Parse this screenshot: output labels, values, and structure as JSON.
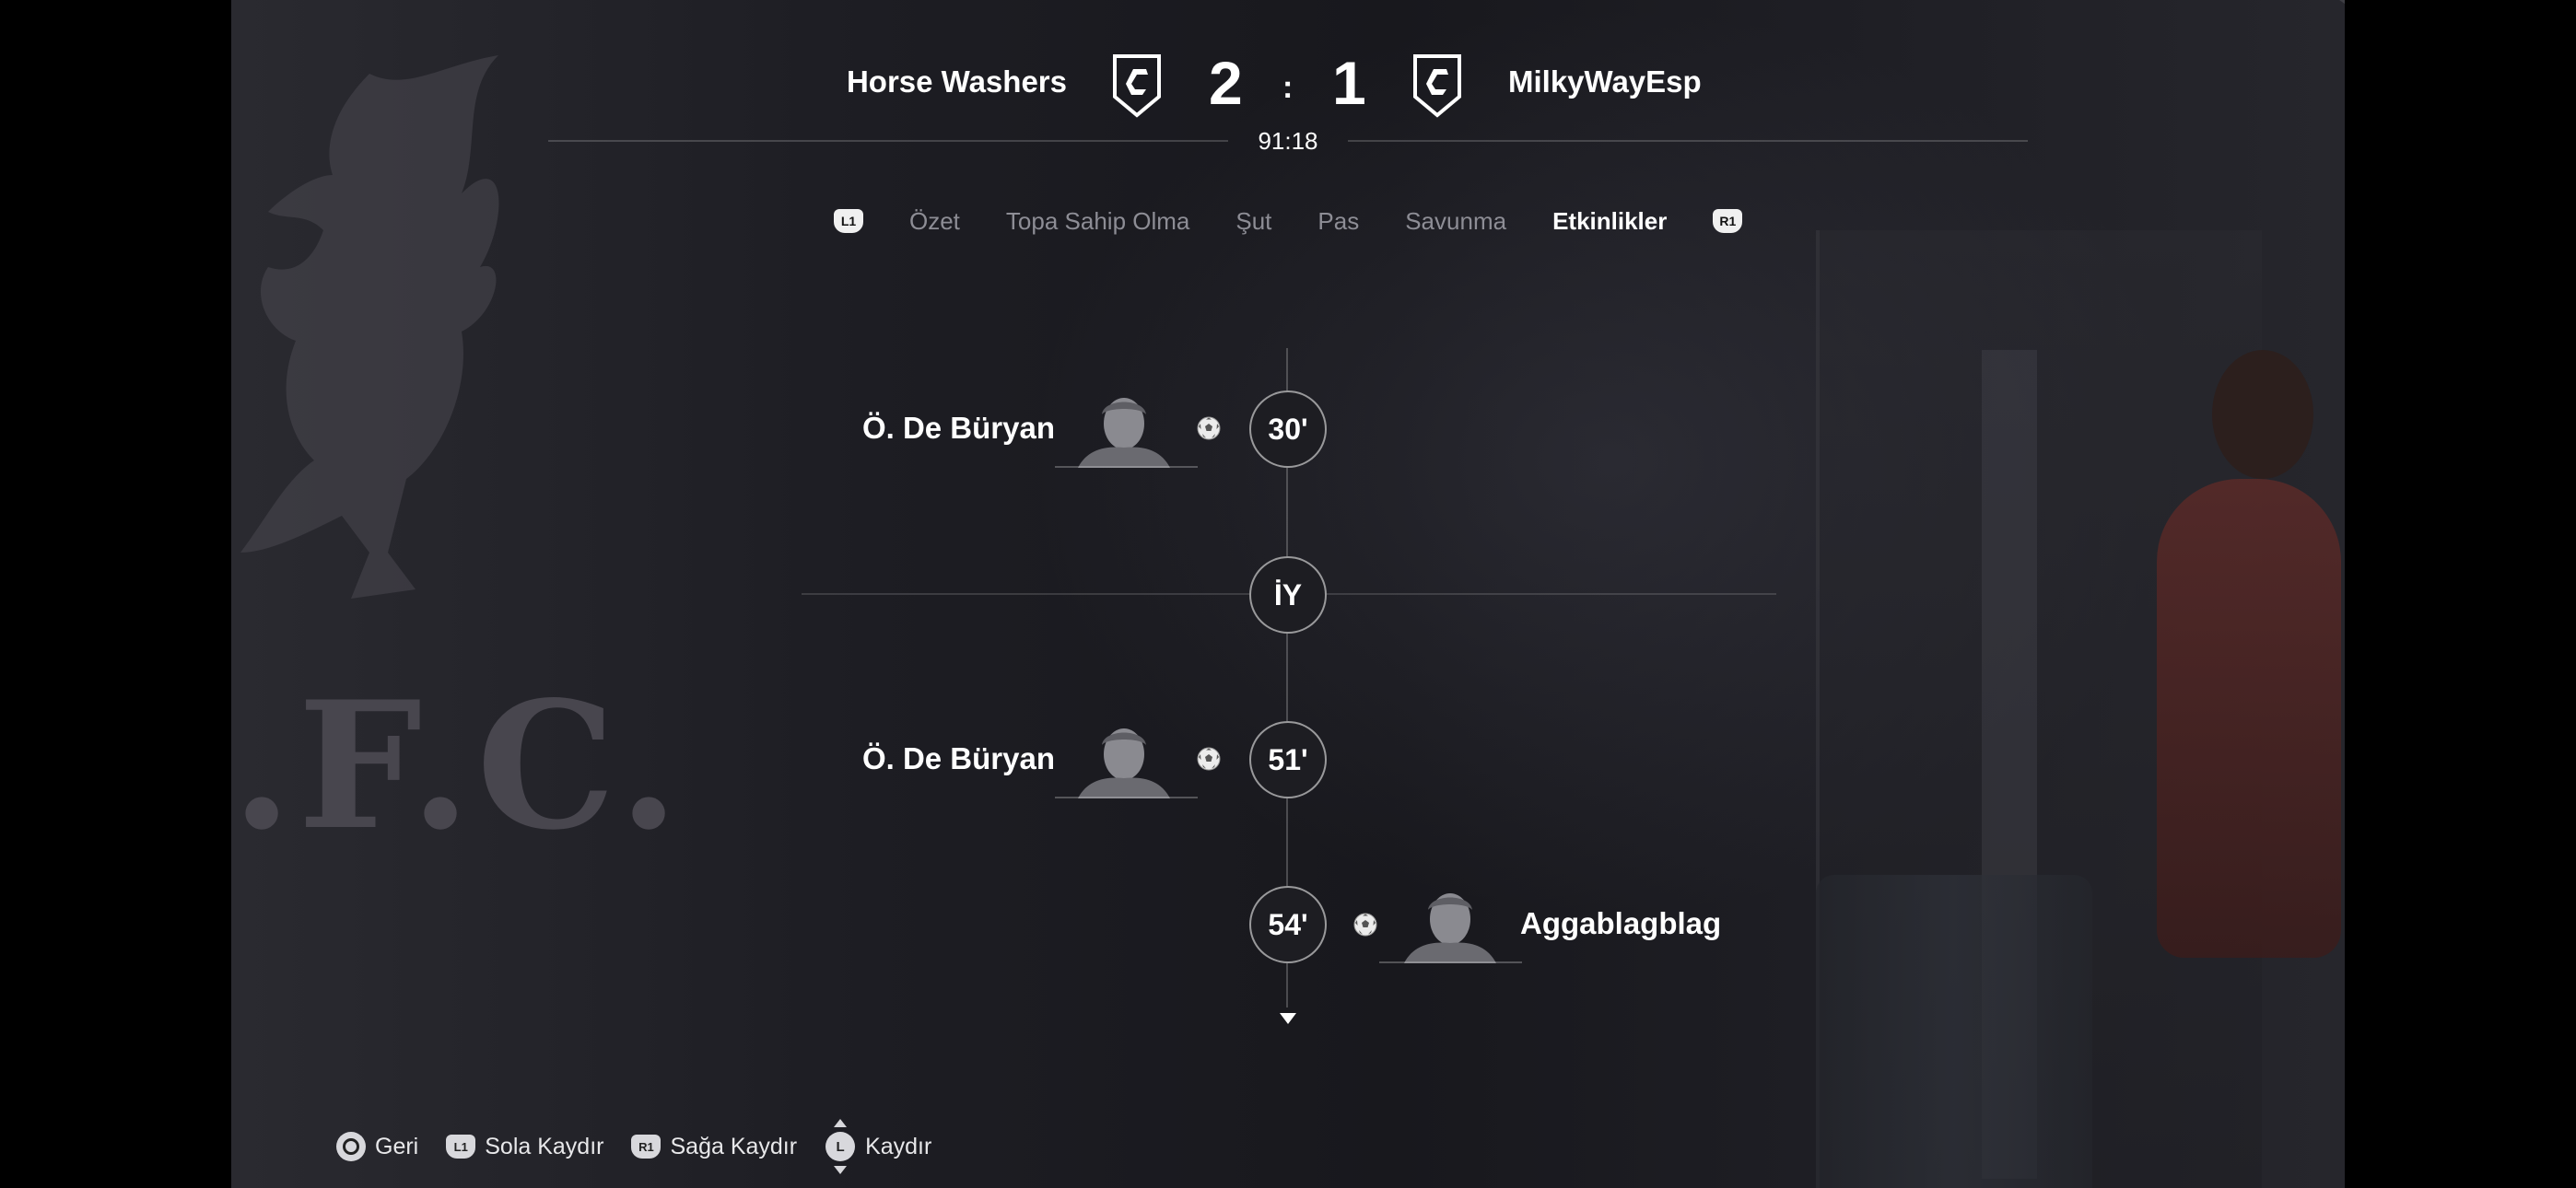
{
  "header": {
    "home_team": "Horse Washers",
    "away_team": "MilkyWayEsp",
    "home_score": "2",
    "away_score": "1",
    "score_separator": ":",
    "match_clock": "91:18",
    "home_crest_icon": "club-crest-icon",
    "away_crest_icon": "club-crest-icon"
  },
  "tabs": {
    "left_button": "L1",
    "right_button": "R1",
    "items": [
      {
        "label": "Özet",
        "active": false
      },
      {
        "label": "Topa Sahip Olma",
        "active": false
      },
      {
        "label": "Şut",
        "active": false
      },
      {
        "label": "Pas",
        "active": false
      },
      {
        "label": "Savunma",
        "active": false
      },
      {
        "label": "Etkinlikler",
        "active": true
      }
    ]
  },
  "timeline": {
    "events": [
      {
        "minute": "30'",
        "player": "Ö. De Büryan",
        "side": "home",
        "type": "goal",
        "icon": "soccer-ball-icon"
      },
      {
        "minute": "İY",
        "type": "half-time"
      },
      {
        "minute": "51'",
        "player": "Ö. De Büryan",
        "side": "home",
        "type": "goal",
        "icon": "soccer-ball-icon"
      },
      {
        "minute": "54'",
        "player": "Aggablagblag",
        "side": "away",
        "type": "goal",
        "icon": "soccer-ball-icon"
      }
    ],
    "more_icon": "chevron-down-icon"
  },
  "footer": {
    "items": [
      {
        "button": "circle",
        "label": "Geri"
      },
      {
        "button": "L1",
        "label": "Sola Kaydır"
      },
      {
        "button": "R1",
        "label": "Sağa Kaydır"
      },
      {
        "button": "L",
        "label": "Kaydır"
      }
    ]
  },
  "colors": {
    "text_primary": "#ffffff",
    "text_inactive": "#8d8d95",
    "background": "#1d1d23"
  }
}
